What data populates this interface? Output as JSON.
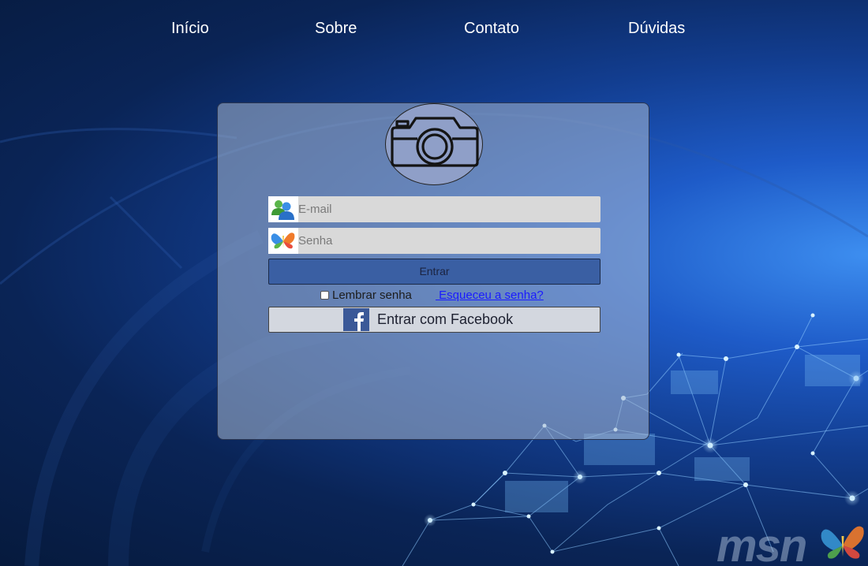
{
  "nav": {
    "items": [
      {
        "label": "Início"
      },
      {
        "label": "Sobre"
      },
      {
        "label": "Contato"
      },
      {
        "label": "Dúvidas"
      }
    ]
  },
  "login": {
    "avatar_icon": "camera-icon",
    "email": {
      "placeholder": "E-mail",
      "value": "",
      "icon": "msn-buddies-icon"
    },
    "password": {
      "placeholder": "Senha",
      "value": "",
      "icon": "msn-butterfly-icon"
    },
    "submit_label": "Entrar",
    "remember_label": "Lembrar senha",
    "remember_checked": false,
    "forgot_label": " Esqueceu a senha?",
    "facebook_label": "Entrar com Facebook",
    "facebook_icon": "facebook-icon"
  },
  "brand": {
    "text": "msn",
    "logo_icon": "msn-butterfly-logo-icon"
  },
  "colors": {
    "background_dark": "#061a3d",
    "background_light": "#3d8ef0",
    "button_primary": "#3a5fa3",
    "link": "#1a1aff",
    "facebook": "#3b5998"
  }
}
